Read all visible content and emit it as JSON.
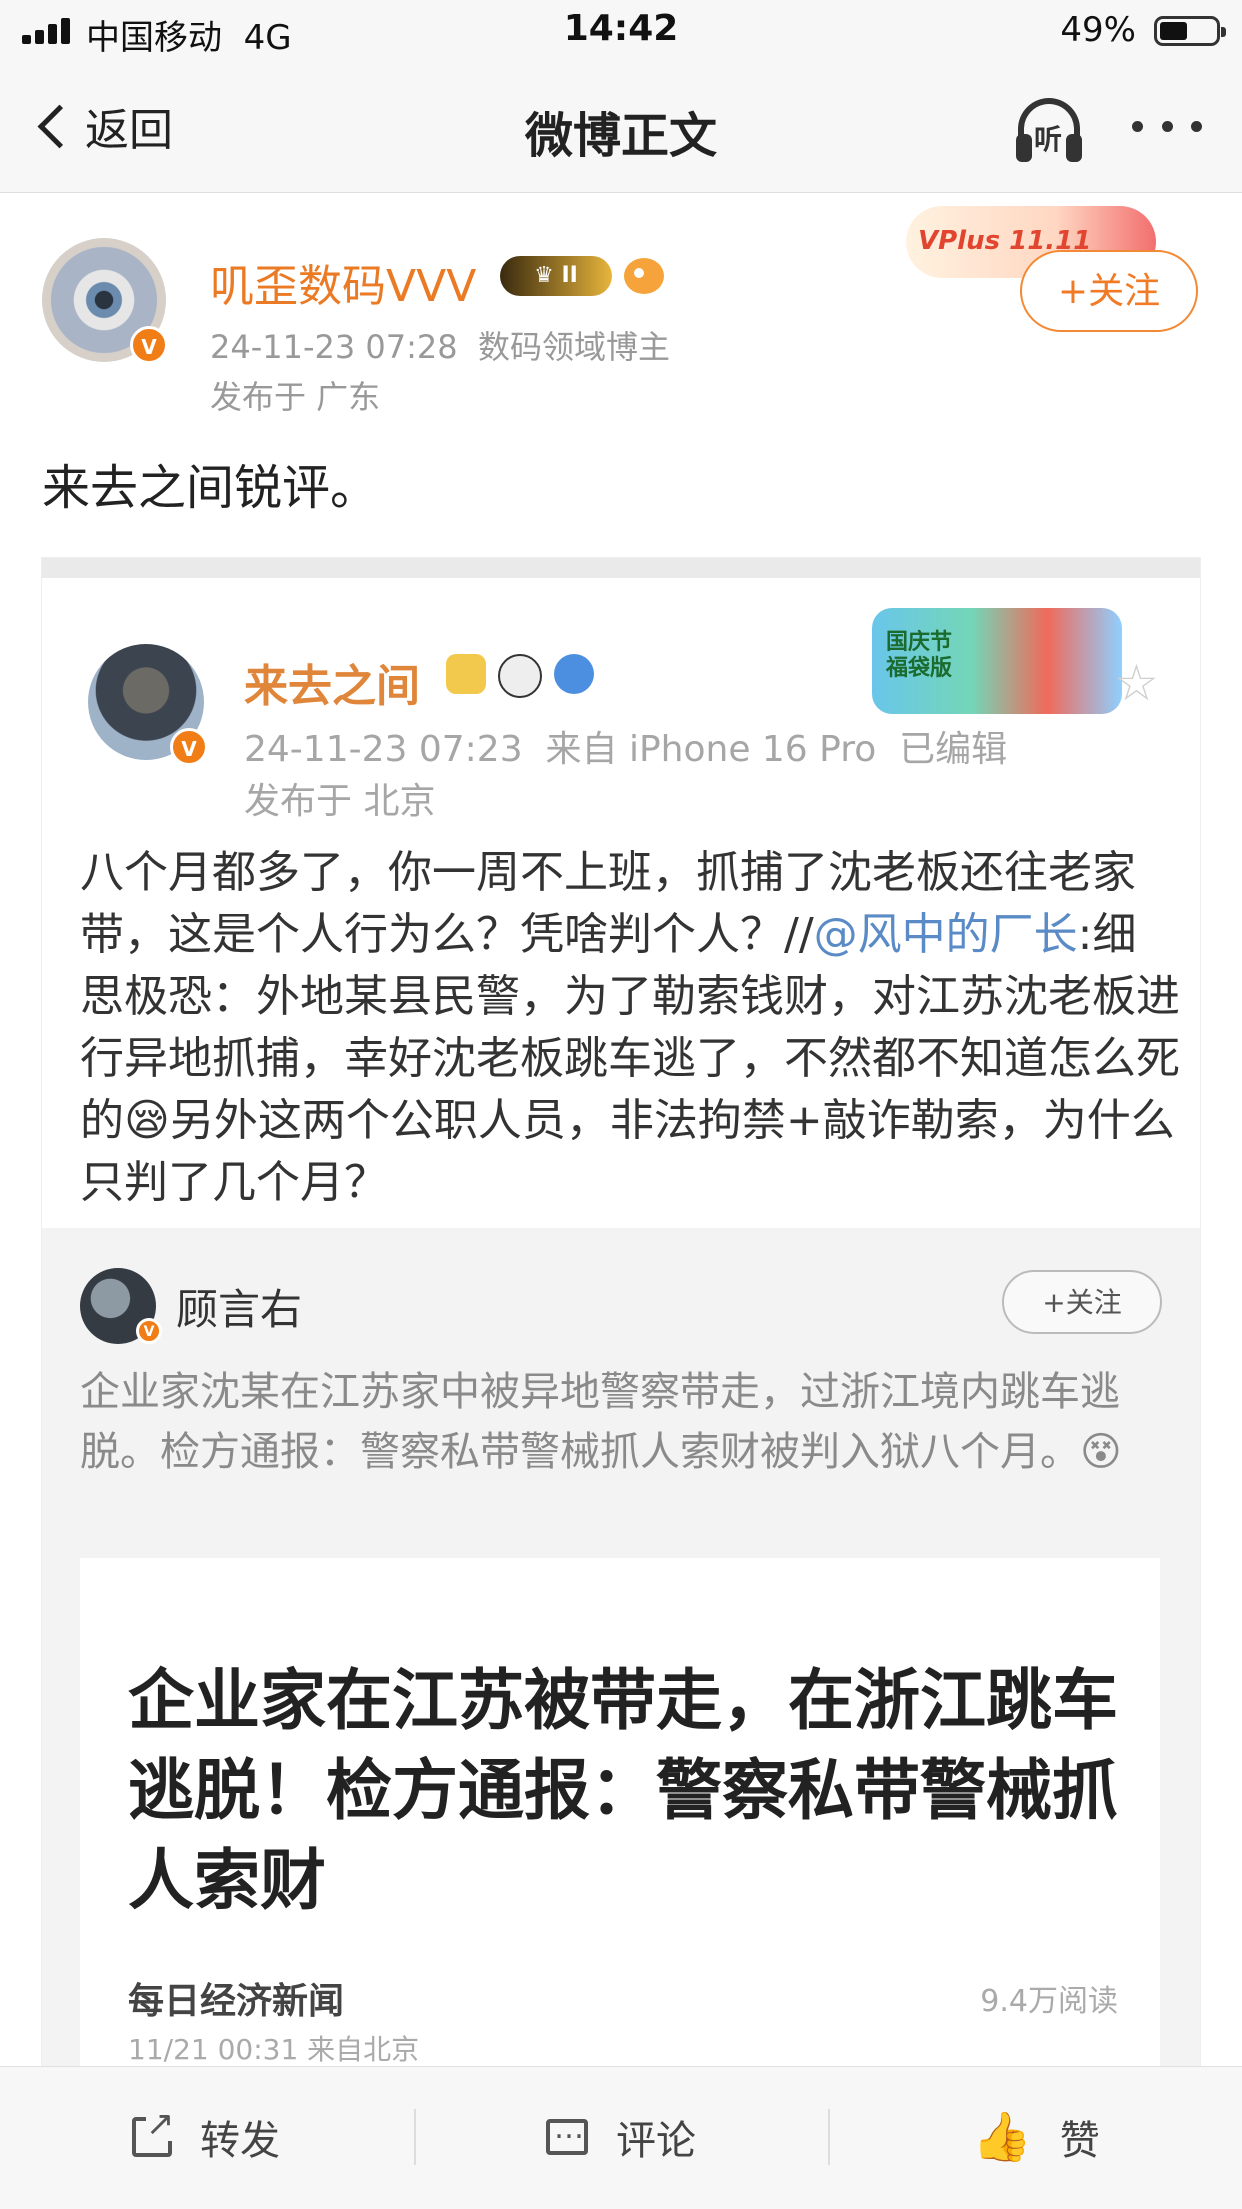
{
  "status_bar": {
    "carrier": "中国移动",
    "network": "4G",
    "time": "14:42",
    "battery": "49%"
  },
  "nav": {
    "back_label": "返回",
    "title": "微博正文",
    "listen_label": "听"
  },
  "post": {
    "username": "叽歪数码VVV",
    "badge_text": "II",
    "timestamp": "24-11-23 07:28",
    "role": "数码领域博主",
    "location": "发布于 广东",
    "follow_label": "+关注",
    "promo": "VPlus 11.11",
    "text": "来去之间锐评。"
  },
  "quoted": {
    "username": "来去之间",
    "timestamp": "24-11-23 07:23",
    "source": "来自 iPhone 16 Pro",
    "edited": "已编辑",
    "location": "发布于 北京",
    "banner_text": "国庆节福袋版",
    "text_before_link": "八个月都多了，你一周不上班，抓捕了沈老板还往老家带，这是个人行为么？凭啥判个人？//",
    "mention": "@风中的厂长",
    "text_after_link": ":细思极恐：外地某县民警，为了勒索钱财，对江苏沈老板进行异地抓捕，幸好沈老板跳车逃了，不然都不知道怎么死的😪另外这两个公职人员，非法拘禁+敲诈勒索，为什么只判了几个月？",
    "inner": {
      "username": "顾言右",
      "follow_label": "+关注",
      "text": "企业家沈某在江苏家中被异地警察带走，过浙江境内跳车逃脱。检方通报：警察私带警械抓人索财被判入狱八个月。😵",
      "card": {
        "title": "企业家在江苏被带走，在浙江跳车逃脱！检方通报：警察私带警械抓人索财",
        "source": "每日经济新闻",
        "reads": "9.4万阅读",
        "date": "11/21 00:31  来自北京"
      }
    }
  },
  "toolbar": {
    "repost_label": "转发",
    "comment_label": "评论",
    "like_label": "赞"
  },
  "colors": {
    "accent_orange": "#eb7a25",
    "link_blue": "#5a8bc6",
    "verified_badge": "#f07d16"
  }
}
